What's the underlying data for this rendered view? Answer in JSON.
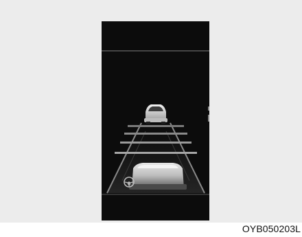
{
  "figure": {
    "code": "OYB050203L",
    "background_color": "#ececec",
    "screen_color": "#0c0c0c"
  },
  "display": {
    "view": "driving-assist-lane-view",
    "icons": [
      "steering-wheel-icon"
    ]
  }
}
